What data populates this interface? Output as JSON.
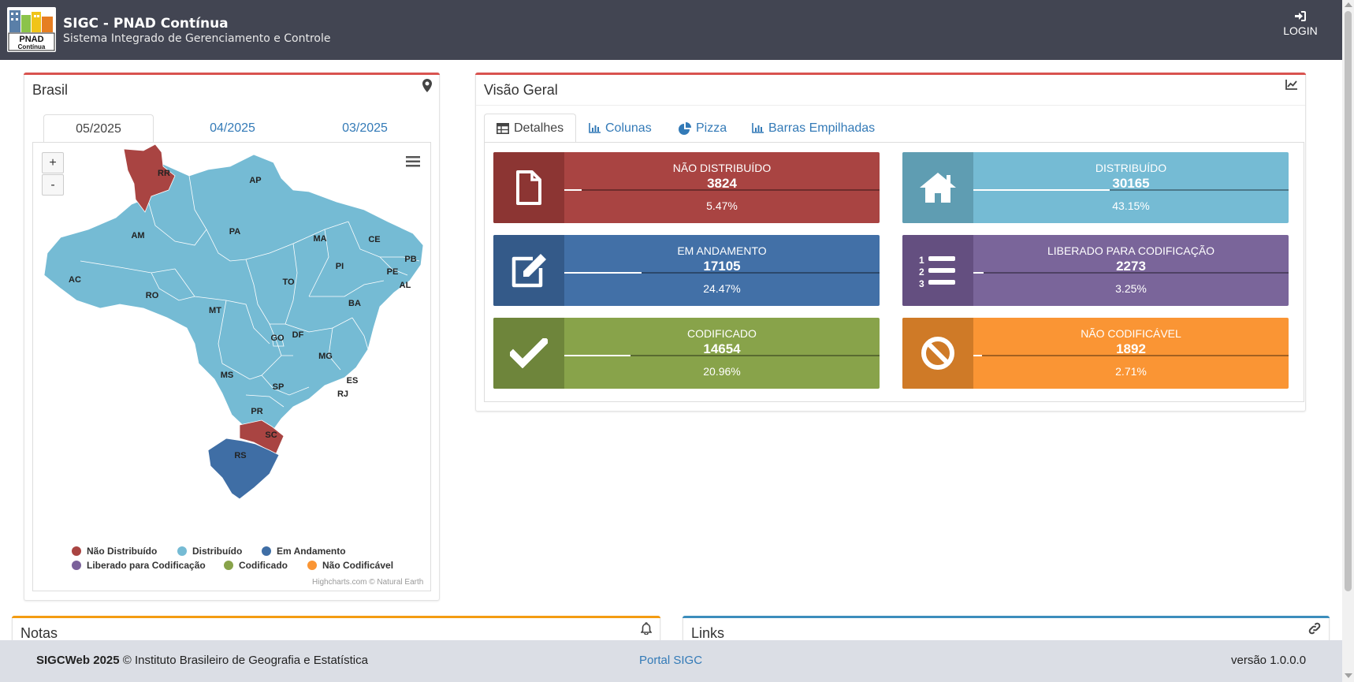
{
  "header": {
    "logo_text_1": "PNAD",
    "logo_text_2": "Contínua",
    "title": "SIGC - PNAD Contínua",
    "subtitle": "Sistema Integrado de Gerenciamento e Controle",
    "login_label": "LOGIN"
  },
  "map_panel": {
    "title": "Brasil",
    "icon": "map-marker-icon",
    "tabs": [
      {
        "label": "05/2025",
        "active": true
      },
      {
        "label": "04/2025",
        "active": false
      },
      {
        "label": "03/2025",
        "active": false
      }
    ],
    "zoom_in": "+",
    "zoom_out": "-",
    "states": {
      "RR": "RR",
      "AP": "AP",
      "AM": "AM",
      "PA": "PA",
      "MA": "MA",
      "CE": "CE",
      "PB": "PB",
      "PE": "PE",
      "AL": "AL",
      "PI": "PI",
      "AC": "AC",
      "RO": "RO",
      "TO": "TO",
      "BA": "BA",
      "MT": "MT",
      "GO": "GO",
      "DF": "DF",
      "MG": "MG",
      "MS": "MS",
      "SP": "SP",
      "ES": "ES",
      "RJ": "RJ",
      "PR": "PR",
      "SC": "SC",
      "RS": "RS"
    },
    "state_status": {
      "RR": "Não Distribuído",
      "SC": "Não Distribuído",
      "RS": "Em Andamento",
      "default": "Distribuído"
    },
    "legend": [
      {
        "label": "Não Distribuído",
        "color": "#a94442"
      },
      {
        "label": "Distribuído",
        "color": "#75bbd4"
      },
      {
        "label": "Em Andamento",
        "color": "#3f6ea5"
      },
      {
        "label": "Liberado para Codificação",
        "color": "#7a619a"
      },
      {
        "label": "Codificado",
        "color": "#88a34a"
      },
      {
        "label": "Não Codificável",
        "color": "#fa9534"
      }
    ],
    "credits": "Highcharts.com © Natural Earth"
  },
  "overview": {
    "title": "Visão Geral",
    "icon": "line-chart-icon",
    "tabs": [
      {
        "label": "Detalhes",
        "icon": "table-icon",
        "active": true
      },
      {
        "label": "Colunas",
        "icon": "bar-chart-icon",
        "active": false
      },
      {
        "label": "Pizza",
        "icon": "pie-chart-icon",
        "active": false
      },
      {
        "label": "Barras Empilhadas",
        "icon": "bar-chart-icon",
        "active": false
      }
    ],
    "cards": [
      {
        "label": "NÃO DISTRIBUÍDO",
        "count": "3824",
        "percent": "5.47%",
        "fraction": 0.0547,
        "icon": "file-icon",
        "color": "#a94442",
        "icon_bg": "#8c3533"
      },
      {
        "label": "DISTRIBUÍDO",
        "count": "30165",
        "percent": "43.15%",
        "fraction": 0.4315,
        "icon": "home-icon",
        "color": "#75bbd4",
        "icon_bg": "#5f9db2"
      },
      {
        "label": "EM ANDAMENTO",
        "count": "17105",
        "percent": "24.47%",
        "fraction": 0.2447,
        "icon": "edit-icon",
        "color": "#4270a7",
        "icon_bg": "#345a89"
      },
      {
        "label": "LIBERADO PARA CODIFICAÇÃO",
        "count": "2273",
        "percent": "3.25%",
        "fraction": 0.0325,
        "icon": "list-ol-icon",
        "color": "#7a659a",
        "icon_bg": "#644f80"
      },
      {
        "label": "CODIFICADO",
        "count": "14654",
        "percent": "20.96%",
        "fraction": 0.2096,
        "icon": "check-icon",
        "color": "#88a34a",
        "icon_bg": "#6e853b"
      },
      {
        "label": "NÃO CODIFICÁVEL",
        "count": "1892",
        "percent": "2.71%",
        "fraction": 0.0271,
        "icon": "ban-icon",
        "color": "#fa9534",
        "icon_bg": "#cf7a27"
      }
    ]
  },
  "notes_panel": {
    "title": "Notas",
    "icon": "bell-icon",
    "accent": "#f39c12"
  },
  "links_panel": {
    "title": "Links",
    "icon": "link-icon",
    "accent": "#3c8dbc"
  },
  "footer": {
    "brand": "SIGCWeb 2025",
    "copyright": "© Instituto Brasileiro de Geografia e Estatística",
    "portal_link": "Portal SIGC",
    "version": "versão 1.0.0.0"
  }
}
